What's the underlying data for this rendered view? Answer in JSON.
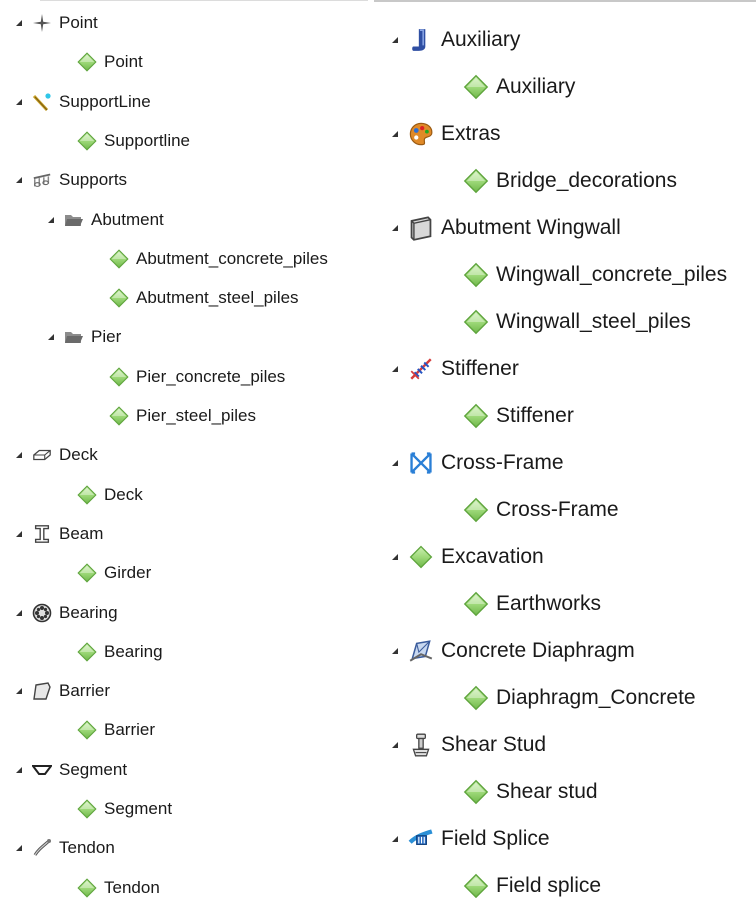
{
  "left_tree": [
    {
      "label": "Point",
      "icon": "point-star-icon",
      "children": [
        {
          "label": "Point"
        }
      ]
    },
    {
      "label": "SupportLine",
      "icon": "support-line-icon",
      "children": [
        {
          "label": "Supportline"
        }
      ]
    },
    {
      "label": "Supports",
      "icon": "supports-icon",
      "children": [
        {
          "label": "Abutment",
          "icon": "folder-open-icon",
          "children": [
            {
              "label": "Abutment_concrete_piles"
            },
            {
              "label": "Abutment_steel_piles"
            }
          ]
        },
        {
          "label": "Pier",
          "icon": "folder-open-icon",
          "children": [
            {
              "label": "Pier_concrete_piles"
            },
            {
              "label": "Pier_steel_piles"
            }
          ]
        }
      ]
    },
    {
      "label": "Deck",
      "icon": "deck-icon",
      "children": [
        {
          "label": "Deck"
        }
      ]
    },
    {
      "label": "Beam",
      "icon": "beam-icon",
      "children": [
        {
          "label": "Girder"
        }
      ]
    },
    {
      "label": "Bearing",
      "icon": "bearing-icon",
      "children": [
        {
          "label": "Bearing"
        }
      ]
    },
    {
      "label": "Barrier",
      "icon": "barrier-icon",
      "children": [
        {
          "label": "Barrier"
        }
      ]
    },
    {
      "label": "Segment",
      "icon": "segment-icon",
      "children": [
        {
          "label": "Segment"
        }
      ]
    },
    {
      "label": "Tendon",
      "icon": "tendon-icon",
      "children": [
        {
          "label": "Tendon"
        }
      ]
    }
  ],
  "right_tree": [
    {
      "label": "Auxiliary",
      "icon": "auxiliary-icon",
      "children": [
        {
          "label": "Auxiliary"
        }
      ]
    },
    {
      "label": "Extras",
      "icon": "extras-palette-icon",
      "children": [
        {
          "label": "Bridge_decorations"
        }
      ]
    },
    {
      "label": "Abutment Wingwall",
      "icon": "wingwall-icon",
      "children": [
        {
          "label": "Wingwall_concrete_piles"
        },
        {
          "label": "Wingwall_steel_piles"
        }
      ]
    },
    {
      "label": "Stiffener",
      "icon": "stiffener-icon",
      "children": [
        {
          "label": "Stiffener"
        }
      ]
    },
    {
      "label": "Cross-Frame",
      "icon": "cross-frame-icon",
      "children": [
        {
          "label": "Cross-Frame"
        }
      ]
    },
    {
      "label": "Excavation",
      "icon": "excavation-diamond-icon",
      "children": [
        {
          "label": "Earthworks"
        }
      ]
    },
    {
      "label": "Concrete Diaphragm",
      "icon": "diaphragm-icon",
      "children": [
        {
          "label": "Diaphragm_Concrete"
        }
      ]
    },
    {
      "label": "Shear Stud",
      "icon": "shear-stud-icon",
      "children": [
        {
          "label": "Shear stud"
        }
      ]
    },
    {
      "label": "Field Splice",
      "icon": "field-splice-icon",
      "children": [
        {
          "label": "Field splice"
        }
      ]
    }
  ],
  "colors": {
    "leaf_diamond_top": "#b9e59c",
    "leaf_diamond_bottom": "#7cc457",
    "expander": "#333333"
  }
}
